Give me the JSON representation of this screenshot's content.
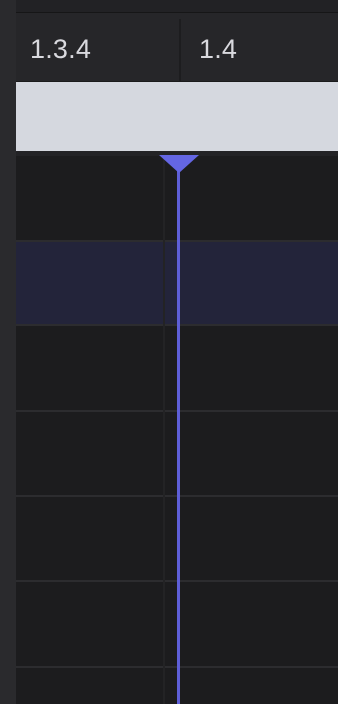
{
  "ruler": {
    "markers": [
      "1.3.4",
      "1.4"
    ]
  },
  "lanes": {
    "count": 6,
    "selected_index": 1
  },
  "colors": {
    "playhead": "#6466e3",
    "loop_range": "#d5d8df",
    "selected_lane": "#23243a"
  }
}
